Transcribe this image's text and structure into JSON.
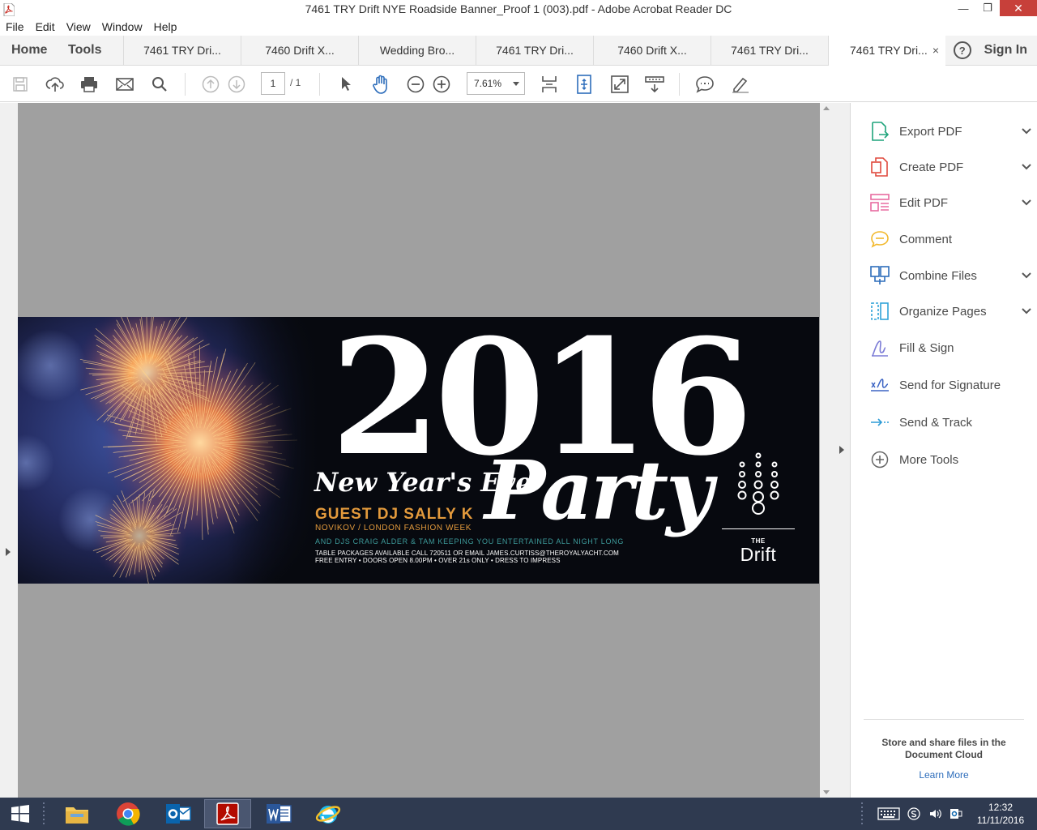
{
  "window": {
    "title": "7461 TRY Drift NYE Roadside Banner_Proof 1 (003).pdf - Adobe Acrobat Reader DC",
    "minimize": "—",
    "restore": "❐",
    "close": "✕"
  },
  "menu": [
    "File",
    "Edit",
    "View",
    "Window",
    "Help"
  ],
  "tabs": {
    "home": "Home",
    "tools": "Tools",
    "documents": [
      "7461 TRY Dri...",
      "7460 Drift X...",
      "Wedding Bro...",
      "7461 TRY Dri...",
      "7460 Drift X...",
      "7461 TRY Dri...",
      "7461 TRY Dri..."
    ],
    "close_glyph": "×",
    "help_glyph": "?",
    "sign_in": "Sign In"
  },
  "toolbar": {
    "page_current": "1",
    "page_total": "/ 1",
    "zoom": "7.61%"
  },
  "banner": {
    "year": "2016",
    "nye": "New Year's Eve",
    "party": "Party",
    "guest_dj": "GUEST DJ SALLY K",
    "novikov": "NOVIKOV / LONDON FASHION WEEK",
    "and_djs": "AND DJS CRAIG ALDER & TAM KEEPING YOU ENTERTAINED ALL NIGHT LONG",
    "table_packages": "TABLE PACKAGES AVAILABLE CALL 720511 OR EMAIL JAMES.CURTISS@THEROYALYACHT.COM",
    "free_entry": "FREE ENTRY • DOORS OPEN 8.00PM • OVER 21s ONLY • DRESS TO IMPRESS",
    "logo_the": "THE",
    "logo_drift": "Drift"
  },
  "tools_pane": {
    "items": [
      {
        "label": "Export PDF",
        "icon": "export-pdf-icon",
        "color": "#1fa47b",
        "chevron": true
      },
      {
        "label": "Create PDF",
        "icon": "create-pdf-icon",
        "color": "#e0493d",
        "chevron": true
      },
      {
        "label": "Edit PDF",
        "icon": "edit-pdf-icon",
        "color": "#e86ba0",
        "chevron": true
      },
      {
        "label": "Comment",
        "icon": "comment-icon",
        "color": "#f2b82b",
        "chevron": false
      },
      {
        "label": "Combine Files",
        "icon": "combine-files-icon",
        "color": "#2d6dbb",
        "chevron": true
      },
      {
        "label": "Organize Pages",
        "icon": "organize-pages-icon",
        "color": "#31a3d8",
        "chevron": true
      },
      {
        "label": "Fill & Sign",
        "icon": "fill-sign-icon",
        "color": "#7b7bd6",
        "chevron": false
      },
      {
        "label": "Send for Signature",
        "icon": "send-signature-icon",
        "color": "#3b63c3",
        "chevron": false
      },
      {
        "label": "Send & Track",
        "icon": "send-track-icon",
        "color": "#2d9bd6",
        "chevron": false
      },
      {
        "label": "More Tools",
        "icon": "more-tools-icon",
        "color": "#666666",
        "chevron": false
      }
    ],
    "cloud_text": "Store and share files in the Document Cloud",
    "learn_more": "Learn More"
  },
  "taskbar": {
    "apps": [
      "file-explorer-icon",
      "chrome-icon",
      "outlook-icon",
      "acrobat-icon",
      "word-icon",
      "internet-explorer-icon"
    ],
    "time": "12:32",
    "date": "11/11/2016"
  },
  "colors": {
    "accent_orange": "#e39a3c",
    "accent_teal": "#3d9b9b",
    "close_red": "#c7403a",
    "link_blue": "#2d6dbb"
  }
}
